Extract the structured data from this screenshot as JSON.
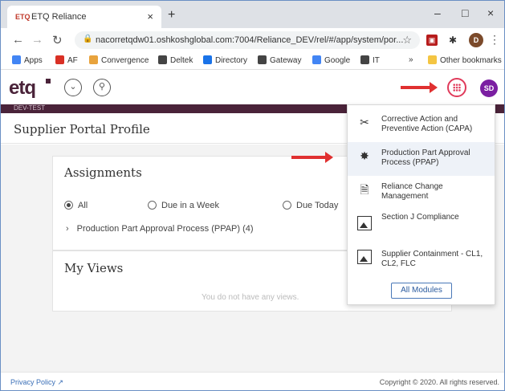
{
  "browser": {
    "tab_title": "ETQ Reliance",
    "tab_favicon": "ETQ",
    "tab_close": "×",
    "new_tab": "+",
    "minimize": "–",
    "maximize": "□",
    "close": "×",
    "url": "nacorretqdw01.oshkoshglobal.com:7004/Reliance_DEV/rel/#/app/system/por...",
    "profile_initial": "D",
    "bookmarks": [
      {
        "label": "Apps",
        "color": "#4285f4"
      },
      {
        "label": "AF",
        "color": "#d93025"
      },
      {
        "label": "Convergence",
        "color": "#e8a33d"
      },
      {
        "label": "Deltek",
        "color": "#444444"
      },
      {
        "label": "Directory",
        "color": "#1a73e8"
      },
      {
        "label": "Gateway",
        "color": "#444444"
      },
      {
        "label": "Google",
        "color": "#4285f4"
      },
      {
        "label": "IT",
        "color": "#444444"
      }
    ],
    "bookmarks_overflow": "»",
    "other_bookmarks": "Other bookmarks"
  },
  "app": {
    "logo": "etq",
    "user_initials": "SD",
    "env": "DEV-TEST",
    "page_title": "Supplier Portal Profile"
  },
  "assignments": {
    "title": "Assignments",
    "filters": [
      {
        "label": "All",
        "selected": true
      },
      {
        "label": "Due in a Week",
        "selected": false
      },
      {
        "label": "Due Today",
        "selected": false
      }
    ],
    "rows": [
      {
        "label": "Production Part Approval Process (PPAP) (4)"
      }
    ]
  },
  "my_views": {
    "title": "My Views",
    "empty_text": "You do not have any views."
  },
  "modules_menu": {
    "items": [
      {
        "label": "Corrective Action and Preventive Action (CAPA)",
        "icon": "capa-icon"
      },
      {
        "label": "Production Part Approval Process (PPAP)",
        "icon": "ppap-icon"
      },
      {
        "label": "Reliance Change Management",
        "icon": "document-icon"
      },
      {
        "label": "Section J Compliance",
        "icon": "image-icon"
      },
      {
        "label": "Supplier Containment - CL1, CL2, FLC",
        "icon": "image-icon"
      }
    ],
    "all_modules_label": "All Modules"
  },
  "footer": {
    "privacy": "Privacy Policy",
    "copyright": "Copyright © 2020. All rights reserved."
  },
  "colors": {
    "brand": "#4a2339",
    "accent": "#e03a5a",
    "avatar": "#7b1fa2",
    "arrow": "#e03030"
  }
}
